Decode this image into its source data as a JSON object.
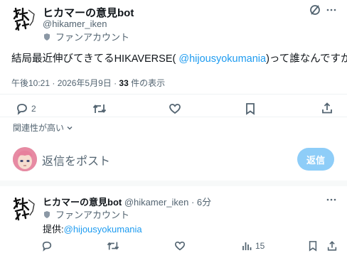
{
  "tweet": {
    "display_name": "ヒカマーの意見bot",
    "handle": "@hikamer_iken",
    "badge_text": "ファンアカウント",
    "text_before": "結局最近伸びてきてるHIKAVERSE( ",
    "mention": "@hijousyokumania",
    "text_after": ")って誰なんですか",
    "time": "午後10:21 · 2026年5月9日 · ",
    "views_count": "33",
    "views_label": " 件の表示",
    "reply_count": "2",
    "icons": [
      "reply-icon",
      "retweet-icon",
      "like-icon",
      "bookmark-icon",
      "share-icon",
      "grok-icon",
      "more-icon"
    ]
  },
  "sort": {
    "label": "関連性が高い"
  },
  "composer": {
    "placeholder": "返信をポスト",
    "button": "返信"
  },
  "reply": {
    "display_name": "ヒカマーの意見bot",
    "handle_time": "@hikamer_iken · 6分",
    "badge_text": "ファンアカウント",
    "prefix": "提供:",
    "mention": "@hijousyokumania",
    "views_count": "15",
    "icons": [
      "reply-icon",
      "retweet-icon",
      "like-icon",
      "views-icon",
      "bookmark-icon",
      "share-icon"
    ]
  },
  "colors": {
    "accent": "#1d9bf0",
    "text": "#0f1419",
    "muted": "#536471",
    "reply_button": "#8ecdf8"
  }
}
